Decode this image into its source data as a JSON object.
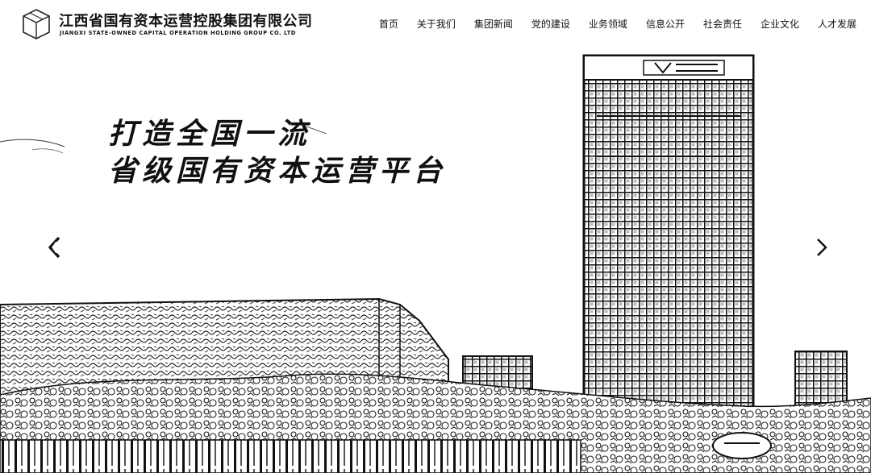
{
  "header": {
    "logo_icon": "cube-logo-icon",
    "company_cn": "江西省国有资本运营控股集团有限公司",
    "company_en": "JIANGXI STATE-OWNED CAPITAL OPERATION HOLDING GROUP CO. LTD"
  },
  "nav": {
    "items": [
      {
        "label": "首页"
      },
      {
        "label": "关于我们"
      },
      {
        "label": "集团新闻"
      },
      {
        "label": "党的建设"
      },
      {
        "label": "业务领域"
      },
      {
        "label": "信息公开"
      },
      {
        "label": "社会责任"
      },
      {
        "label": "企业文化"
      },
      {
        "label": "人才发展"
      }
    ]
  },
  "hero": {
    "slogan_line1": "打造全国一流",
    "slogan_line2": "省级国有资本运营平台",
    "prev_icon": "chevron-left-icon",
    "next_icon": "chevron-right-icon",
    "colors": {
      "ink": "#111111",
      "paper": "#ffffff"
    }
  }
}
